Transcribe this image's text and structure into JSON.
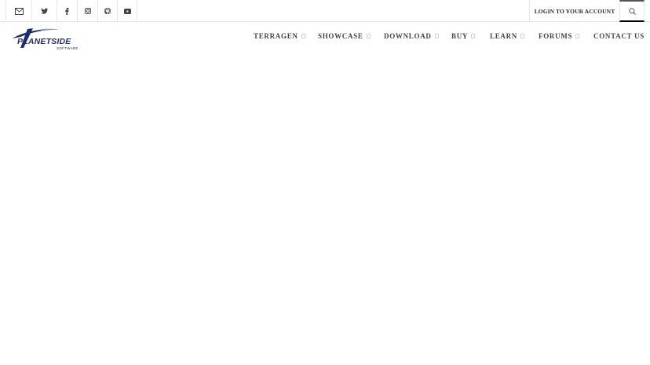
{
  "topbar": {
    "social": [
      {
        "icon": "mail-icon"
      },
      {
        "icon": "twitter-icon"
      },
      {
        "icon": "facebook-icon"
      },
      {
        "icon": "instagram-icon"
      },
      {
        "icon": "github-icon"
      },
      {
        "icon": "youtube-icon"
      }
    ],
    "login_label": "LOGIN TO YOUR ACCOUNT",
    "search_icon": "search-icon"
  },
  "logo": {
    "brand": "PLANETSIDE",
    "sub": "SOFTWARE"
  },
  "nav": {
    "items": [
      {
        "label": "TERRAGEN",
        "has_dropdown": true
      },
      {
        "label": "SHOWCASE",
        "has_dropdown": true
      },
      {
        "label": "DOWNLOAD",
        "has_dropdown": true
      },
      {
        "label": "BUY",
        "has_dropdown": true
      },
      {
        "label": "LEARN",
        "has_dropdown": true
      },
      {
        "label": "FORUMS",
        "has_dropdown": true
      },
      {
        "label": "CONTACT US",
        "has_dropdown": false
      }
    ]
  },
  "colors": {
    "brand": "#1d2e6b",
    "nav_text": "#444444",
    "border": "#e6e6e6"
  }
}
